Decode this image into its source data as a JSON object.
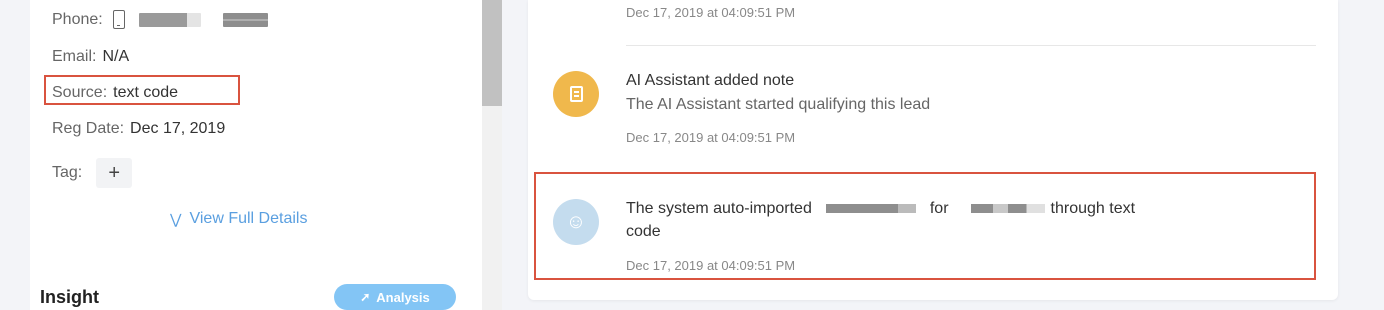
{
  "lead": {
    "phone_label": "Phone:",
    "email_label": "Email:",
    "email_value": "N/A",
    "source_label": "Source:",
    "source_value": "text code",
    "reg_label": "Reg Date:",
    "reg_value": "Dec 17, 2019",
    "tag_label": "Tag:",
    "tag_add": "+",
    "view_details": "View Full Details"
  },
  "insight": {
    "title": "Insight",
    "analysis_label": "Analysis"
  },
  "timeline": {
    "events": [
      {
        "timestamp": "Dec 17, 2019 at 04:09:51 PM"
      },
      {
        "title": "AI Assistant added note",
        "body": "The AI Assistant started qualifying this lead",
        "timestamp": "Dec 17, 2019 at 04:09:51 PM"
      },
      {
        "text_a": "The system auto-imported",
        "text_b": "for",
        "text_c": "through text",
        "text_d": "code",
        "timestamp": "Dec 17, 2019 at 04:09:51 PM"
      }
    ]
  },
  "colors": {
    "highlight": "#d9533f",
    "accent": "#5a9fe0",
    "note_avatar": "#f0b84c",
    "user_avatar": "#c4dcee"
  },
  "icons": [
    "phone-icon",
    "chevron-down-double-icon",
    "trend-icon",
    "note-icon",
    "user-add-icon"
  ]
}
